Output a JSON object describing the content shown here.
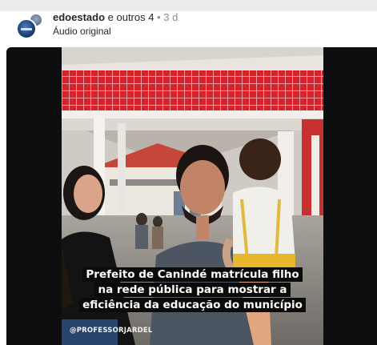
{
  "post": {
    "author": "edoestado",
    "coauthors": "e outros 4",
    "separator": "•",
    "time": "3 d",
    "audio": "Áudio original"
  },
  "video": {
    "caption_lines": [
      "Prefeito de Canindé matrícula filho",
      "na rede pública para mostrar a",
      "eficiência da educação do município"
    ],
    "credit": "@PROFESSORJARDEL"
  },
  "icons": [
    "avatar-edoestado",
    "avatar-coauthor"
  ],
  "colors": {
    "tile_red": "#d9262c",
    "background": "#0d0e10"
  }
}
